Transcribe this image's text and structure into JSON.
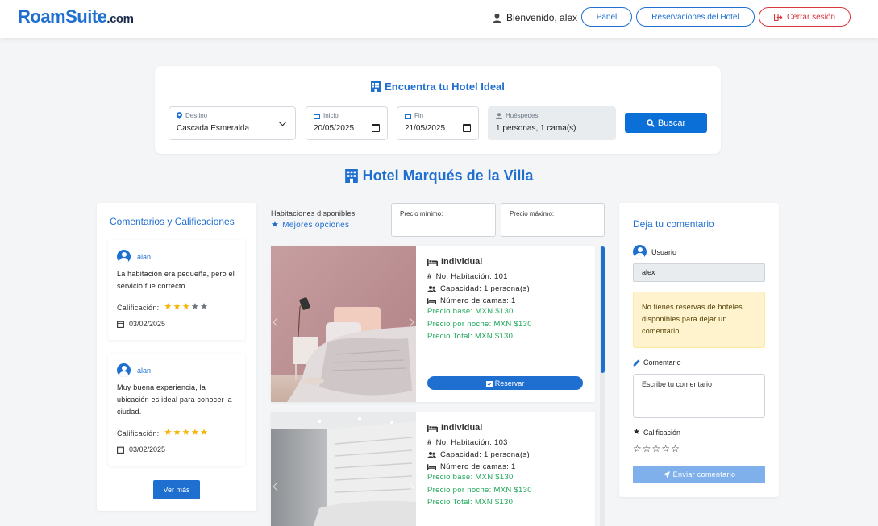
{
  "brand": {
    "name_main": "RoamSuite",
    "name_roam": "Roam",
    "name_suite": "Suite",
    "name_tld": ".com"
  },
  "nav": {
    "greeting": "Bienvenido, alex",
    "panel": "Panel",
    "reservations": "Reservaciones del Hotel",
    "logout": "Cerrar sesión"
  },
  "search": {
    "title": "Encuentra tu Hotel Ideal",
    "destination_label": "Destino",
    "destination_value": "Cascada Esmeralda",
    "start_label": "Inicio",
    "start_value": "20/05/2025",
    "end_label": "Fin",
    "end_value": "21/05/2025",
    "guests_label": "Huéspedes",
    "guests_value": "1 personas, 1 cama(s)",
    "button": "Buscar"
  },
  "hotel": {
    "name": "Hotel Marqués de la Villa"
  },
  "reviews": {
    "title": "Comentarios y Calificaciones",
    "rating_label": "Calificación:",
    "items": [
      {
        "user": "alan",
        "text": "La habitación era pequeña, pero el servicio fue correcto.",
        "rating": 3,
        "date": "03/02/2025"
      },
      {
        "user": "alan",
        "text": "Muy buena experiencia, la ubicación es ideal para conocer la ciudad.",
        "rating": 5,
        "date": "03/02/2025"
      }
    ],
    "more_button": "Ver más"
  },
  "rooms": {
    "available_label": "Habitaciones disponibles",
    "best_options": "Mejores opciones",
    "price_min_label": "Precio mínimo:",
    "price_max_label": "Precio máximo:",
    "reserve_button": "Reservar",
    "items": [
      {
        "type": "Individual",
        "number": "No. Habitación: 101",
        "capacity": "Capacidad: 1 persona(s)",
        "beds": "Número de camas: 1",
        "base_price": "Precio base: MXN $130",
        "night_price": "Precio por noche: MXN $130",
        "total_price": "Precio Total: MXN $130"
      },
      {
        "type": "Individual",
        "number": "No. Habitación: 103",
        "capacity": "Capacidad: 1 persona(s)",
        "beds": "Número de camas: 1",
        "base_price": "Precio base: MXN $130",
        "night_price": "Precio por noche: MXN $130",
        "total_price": "Precio Total: MXN $130"
      }
    ]
  },
  "comment_form": {
    "title": "Deja tu comentario",
    "user_label": "Usuario",
    "user_value": "alex",
    "alert": "No tienes reservas de hoteles disponibles para dejar un comentario.",
    "comment_label": "Comentario",
    "comment_placeholder": "Escribe tu comentario",
    "rating_label": "Calificación",
    "send_button": "Enviar comentario"
  },
  "colors": {
    "primary": "#1f6fd1",
    "danger": "#d9363e",
    "success": "#1fa65a",
    "star": "#f4b400"
  }
}
